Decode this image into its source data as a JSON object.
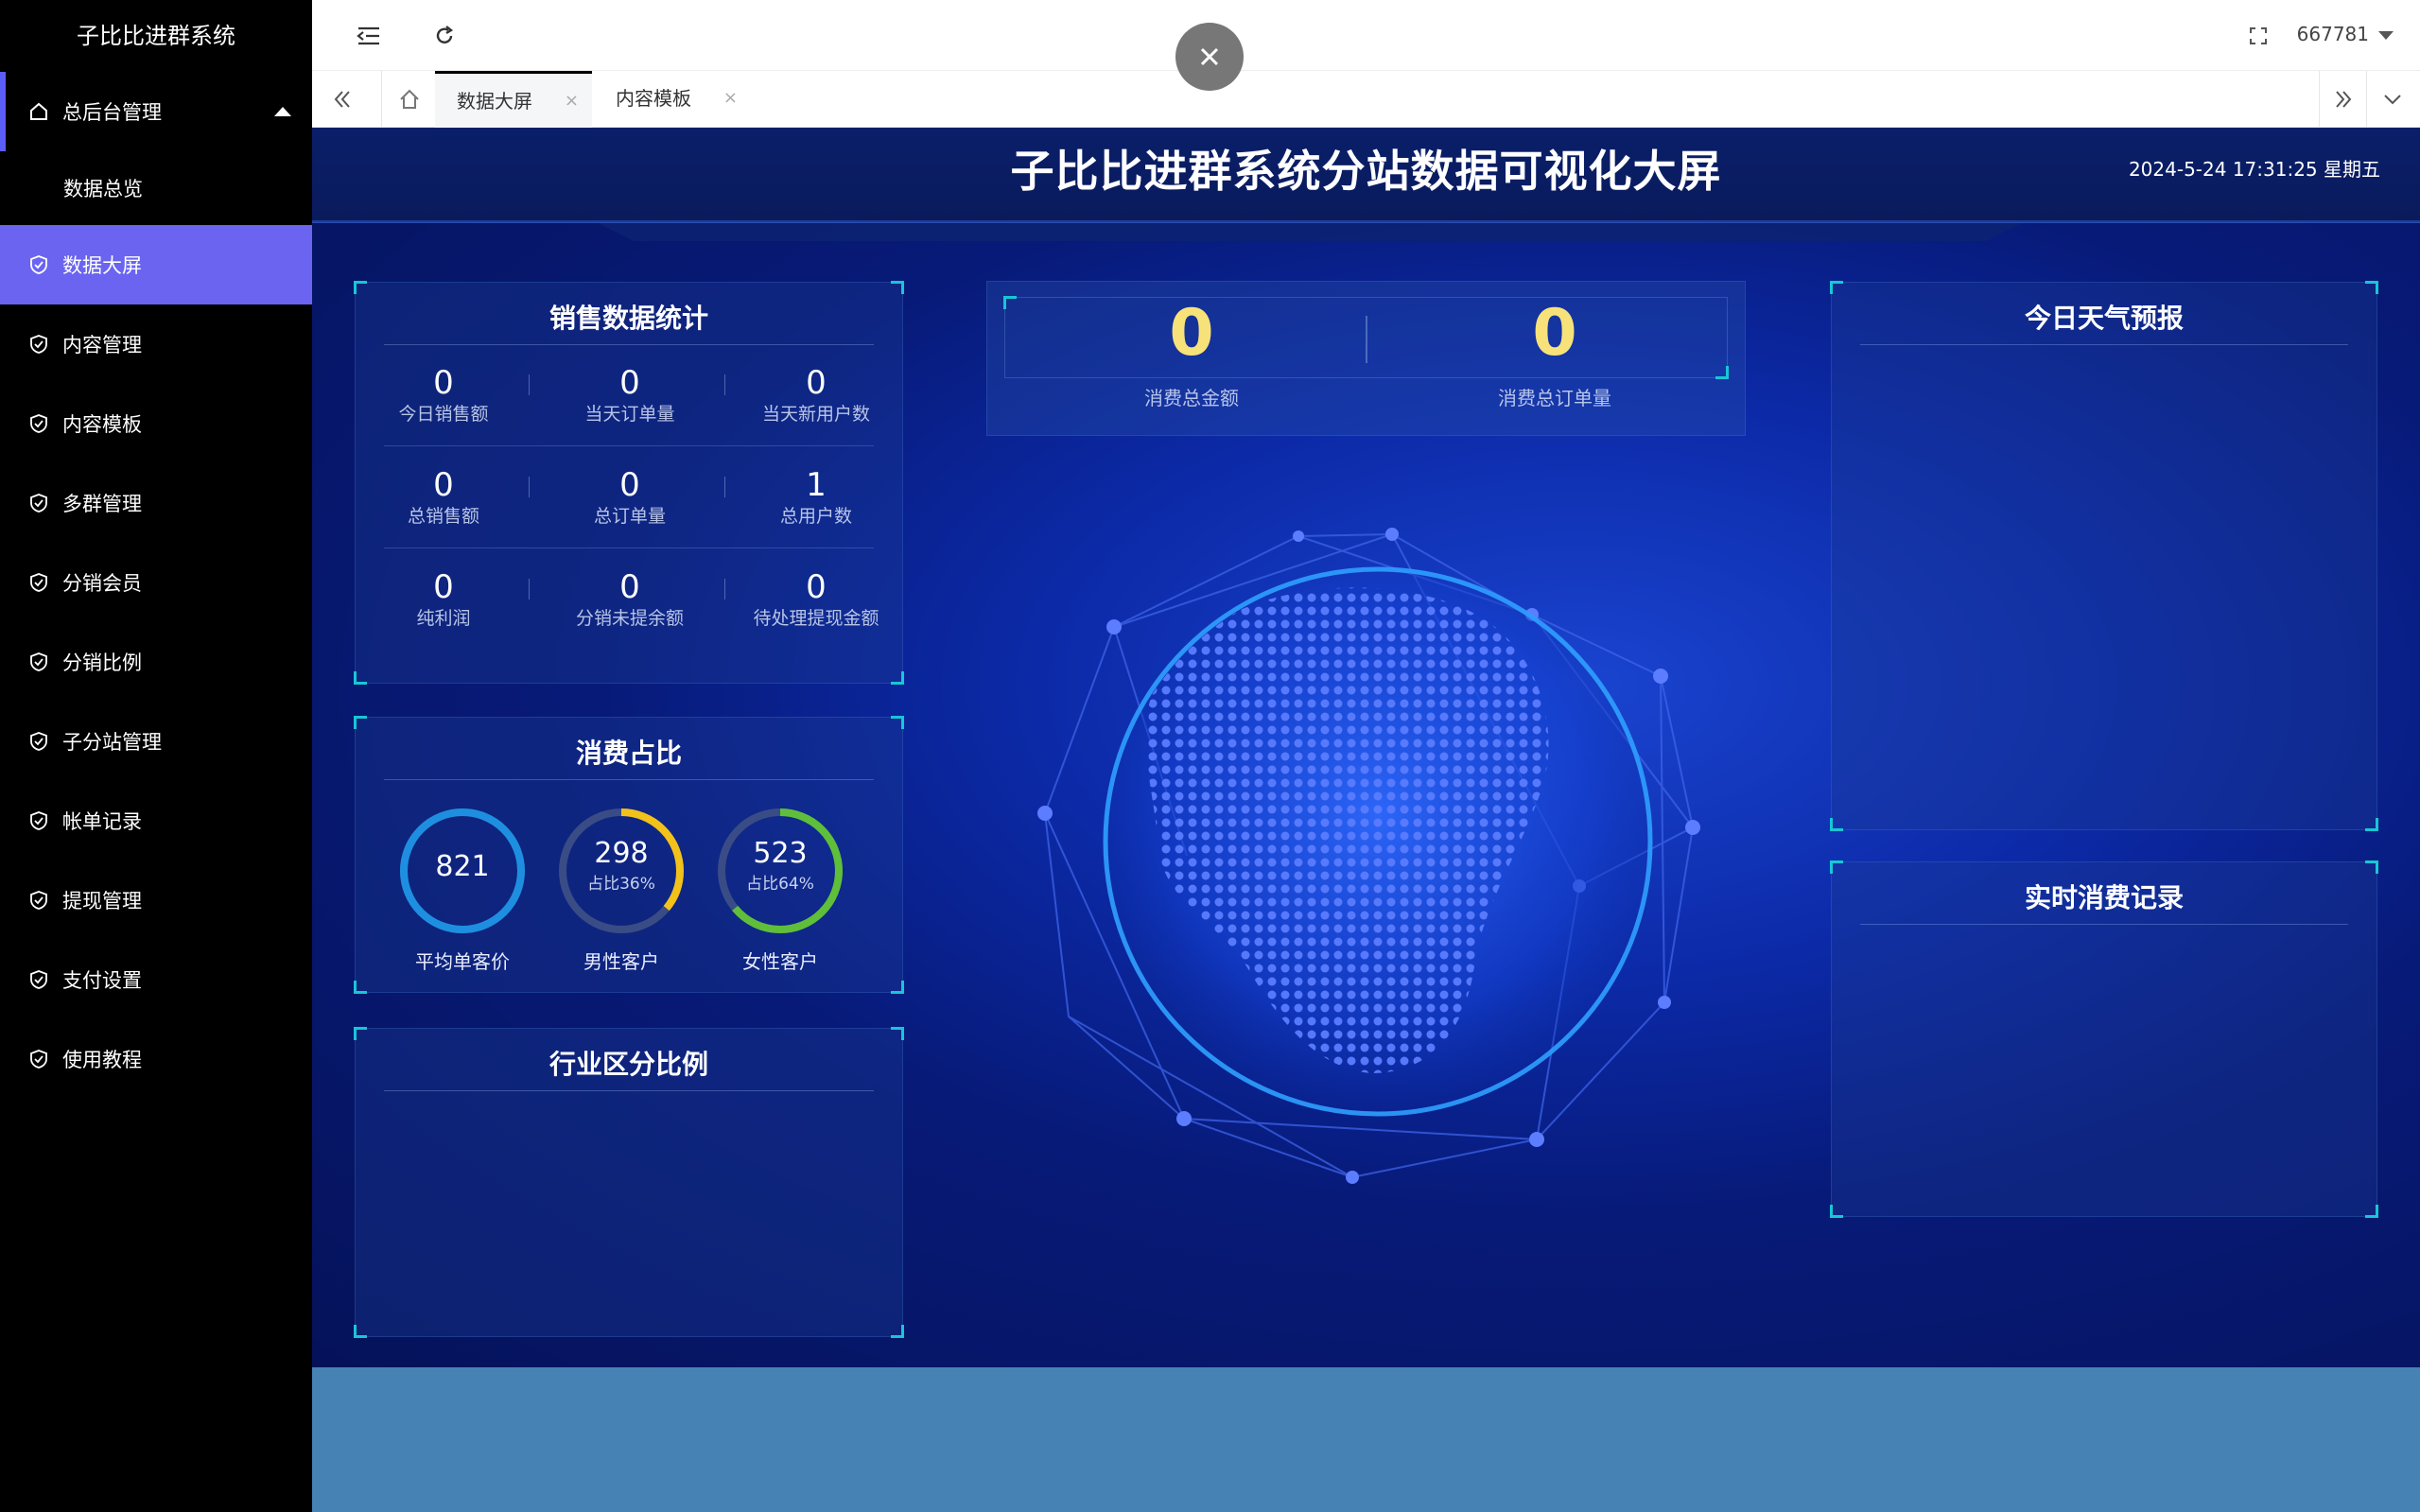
{
  "sidebar": {
    "app_title": "子比比进群系统",
    "parent": "总后台管理",
    "items": [
      {
        "label": "数据总览"
      },
      {
        "label": "数据大屏"
      },
      {
        "label": "内容管理"
      },
      {
        "label": "内容模板"
      },
      {
        "label": "多群管理"
      },
      {
        "label": "分销会员"
      },
      {
        "label": "分销比例"
      },
      {
        "label": "子分站管理"
      },
      {
        "label": "帐单记录"
      },
      {
        "label": "提现管理"
      },
      {
        "label": "支付设置"
      },
      {
        "label": "使用教程"
      }
    ]
  },
  "topbar": {
    "user": "667781"
  },
  "tabs": [
    {
      "label": "数据大屏",
      "close": "×"
    },
    {
      "label": "内容模板",
      "close": "×"
    }
  ],
  "dashboard": {
    "title": "子比比进群系统分站数据可视化大屏",
    "datetime": "2024-5-24 17:31:25 星期五",
    "sales": {
      "title": "销售数据统计",
      "stats": [
        {
          "value": "0",
          "label": "今日销售额"
        },
        {
          "value": "0",
          "label": "当天订单量"
        },
        {
          "value": "0",
          "label": "当天新用户数"
        },
        {
          "value": "0",
          "label": "总销售额"
        },
        {
          "value": "0",
          "label": "总订单量"
        },
        {
          "value": "1",
          "label": "总用户数"
        },
        {
          "value": "0",
          "label": "纯利润"
        },
        {
          "value": "0",
          "label": "分销未提余额"
        },
        {
          "value": "0",
          "label": "待处理提现金额"
        }
      ]
    },
    "consumption": {
      "title": "消费占比",
      "rings": [
        {
          "value": "821",
          "sub": "",
          "label": "平均单客价",
          "fraction": 1.0,
          "color": "#1e8fe0"
        },
        {
          "value": "298",
          "sub": "占比36%",
          "label": "男性客户",
          "fraction": 0.36,
          "color": "#f2c21b"
        },
        {
          "value": "523",
          "sub": "占比64%",
          "label": "女性客户",
          "fraction": 0.64,
          "color": "#5fbf3a"
        }
      ]
    },
    "industry": {
      "title": "行业区分比例"
    },
    "kpis": [
      {
        "value": "0",
        "label": "消费总金额"
      },
      {
        "value": "0",
        "label": "消费总订单量"
      }
    ],
    "weather": {
      "title": "今日天气预报"
    },
    "realtime": {
      "title": "实时消费记录"
    }
  },
  "colors": {
    "sidebar_bg": "#000000",
    "sidebar_active": "#6a64f1",
    "kpi_yellow": "#f7e27a",
    "corner_cyan": "#18c6d6"
  }
}
